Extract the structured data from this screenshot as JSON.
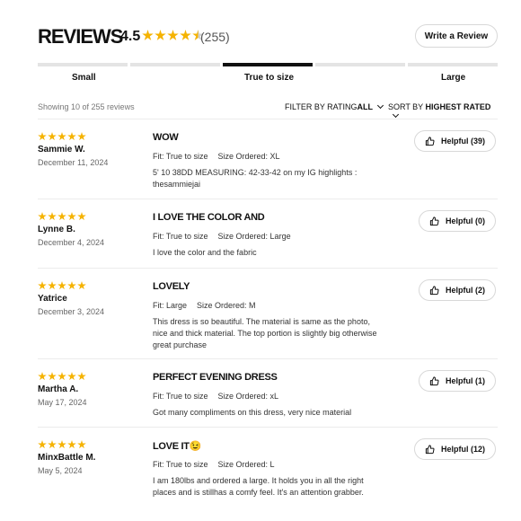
{
  "header": {
    "title": "REVIEWS",
    "average": "4.5",
    "count": "(255)",
    "write_label": "Write a Review"
  },
  "rating_stars": 4.5,
  "fit": {
    "labels": [
      "Small",
      "True to size",
      "Large"
    ],
    "selected": "True to size"
  },
  "toolbar": {
    "showing": "Showing 10 of 255 reviews",
    "filter_label": "FILTER BY RATING",
    "filter_value": "ALL",
    "sort_label": "SORT BY",
    "sort_value": "HIGHEST RATED"
  },
  "reviews": [
    {
      "stars": 5,
      "name": "Sammie W.",
      "date": "December 11, 2024",
      "title": "WOW",
      "fit": "Fit: True to size",
      "size": "Size Ordered: XL",
      "body": "5' 10 38DD MEASURING: 42-33-42 on my IG highlights : thesammiejai",
      "helpful": "Helpful (39)"
    },
    {
      "stars": 5,
      "name": "Lynne B.",
      "date": "December 4, 2024",
      "title": "I LOVE THE COLOR AND",
      "fit": "Fit: True to size",
      "size": "Size Ordered: Large",
      "body": "I love the color and the fabric",
      "helpful": "Helpful (0)"
    },
    {
      "stars": 5,
      "name": "Yatrice",
      "date": "December 3, 2024",
      "title": "LOVELY",
      "fit": "Fit: Large",
      "size": "Size Ordered: M",
      "body": "This dress is so beautiful. The material is same as the photo, nice and thick material. The top portion is slightly big otherwise great purchase",
      "helpful": "Helpful (2)"
    },
    {
      "stars": 5,
      "name": "Martha A.",
      "date": "May 17, 2024",
      "title": "PERFECT EVENING DRESS",
      "fit": "Fit: True to size",
      "size": "Size Ordered: xL",
      "body": "Got many compliments on this dress, very nice material",
      "helpful": "Helpful (1)"
    },
    {
      "stars": 5,
      "name": "MinxBattle M.",
      "date": "May 5, 2024",
      "title": "LOVE IT😉",
      "fit": "Fit: True to size",
      "size": "Size Ordered: L",
      "body": "I am 180lbs and ordered a large. It holds you in all the right places and is stillhas a comfy feel. It's an attention grabber.",
      "helpful": "Helpful (12)"
    }
  ],
  "colors": {
    "star": "#f5b301",
    "track": "#e4e4e4",
    "track_active": "#111111"
  },
  "icons": [
    "star-icon",
    "half-star-icon",
    "thumbs-up-icon",
    "chevron-down-icon"
  ]
}
